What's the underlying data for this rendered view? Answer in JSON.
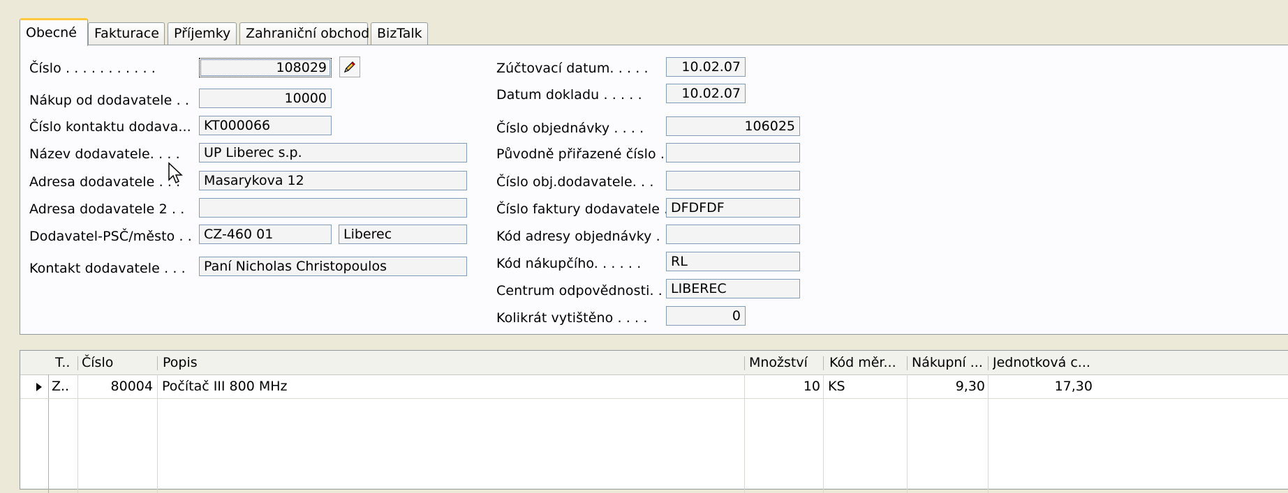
{
  "tabs": [
    "Obecné",
    "Fakturace",
    "Příjemky",
    "Zahraniční obchod",
    "BizTalk"
  ],
  "left_fields": {
    "cislo": {
      "label": "Číslo . . . . . . . . . . .",
      "value": "108029"
    },
    "nakup_od": {
      "label": "Nákup od dodavatele . .",
      "value": "10000"
    },
    "kontakt_cislo": {
      "label": "Číslo kontaktu dodava...",
      "value": "KT000066"
    },
    "nazev": {
      "label": "Název dodavatele. . . .",
      "value": "UP Liberec s.p."
    },
    "adresa": {
      "label": "Adresa dodavatele . . .",
      "value": "Masarykova 12"
    },
    "adresa2": {
      "label": "Adresa dodavatele 2 . .",
      "value": ""
    },
    "psc_mesto": {
      "label": "Dodavatel-PSČ/město . .",
      "psc": "CZ-460 01",
      "mesto": "Liberec"
    },
    "kontakt": {
      "label": "Kontakt dodavatele . . .",
      "value": "Paní Nicholas Christopoulos"
    }
  },
  "right_fields": {
    "zuctovaci": {
      "label": "Zúčtovací datum. . . . .",
      "value": "10.02.07"
    },
    "datum_dokladu": {
      "label": "Datum dokladu . . . . .",
      "value": "10.02.07"
    },
    "cislo_obj": {
      "label": "Číslo objednávky . . . .",
      "value": "106025"
    },
    "puvodne": {
      "label": "Původně přiřazené číslo .",
      "value": ""
    },
    "obj_dodavatele": {
      "label": "Číslo obj.dodavatele. . .",
      "value": ""
    },
    "faktura_dodavatele": {
      "label": "Číslo faktury dodavatele .",
      "value": "DFDFDF"
    },
    "kod_adresy": {
      "label": "Kód adresy objednávky .",
      "value": ""
    },
    "kod_nakupciho": {
      "label": "Kód nákupčího. . . . . .",
      "value": "RL"
    },
    "centrum": {
      "label": "Centrum odpovědnosti. .",
      "value": "LIBEREC"
    },
    "vytisteno": {
      "label": "Kolikrát vytištěno . . . .",
      "value": "0"
    }
  },
  "lines": {
    "columns": [
      "T..",
      "Číslo",
      "Popis",
      "Množství",
      "Kód měr...",
      "Nákupní ...",
      "Jednotková c..."
    ],
    "rows": [
      {
        "typ": "Z..",
        "cislo": "80004",
        "popis": "Počítač III 800 MHz",
        "mnozstvi": "10",
        "kod_mer": "KS",
        "nakupni": "9,30",
        "jednotkova": "17,30"
      }
    ]
  }
}
